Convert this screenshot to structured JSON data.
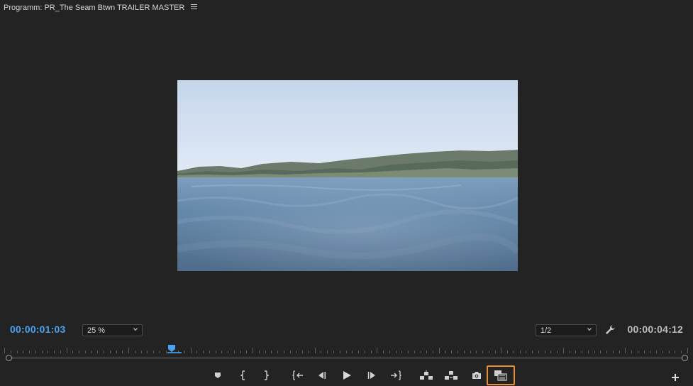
{
  "panel": {
    "title": "Programm: PR_The Seam Btwn TRAILER MASTER",
    "menu_icon": "hamburger-menu-icon"
  },
  "viewer": {
    "content": "video-frame-ocean-horizon"
  },
  "timecodes": {
    "current": "00:00:01:03",
    "duration": "00:00:04:12"
  },
  "zoom": {
    "selected": "25 %"
  },
  "playback_resolution": {
    "selected": "1/2"
  },
  "transport_buttons": [
    {
      "name": "add-marker-button",
      "icon": "marker-icon"
    },
    {
      "name": "mark-in-button",
      "icon": "mark-in-icon"
    },
    {
      "name": "mark-out-button",
      "icon": "mark-out-icon"
    },
    {
      "name": "go-to-in-button",
      "icon": "go-to-in-icon"
    },
    {
      "name": "step-back-button",
      "icon": "step-back-icon"
    },
    {
      "name": "play-button",
      "icon": "play-icon"
    },
    {
      "name": "step-forward-button",
      "icon": "step-forward-icon"
    },
    {
      "name": "go-to-out-button",
      "icon": "go-to-out-icon"
    },
    {
      "name": "lift-button",
      "icon": "lift-icon"
    },
    {
      "name": "extract-button",
      "icon": "extract-icon"
    },
    {
      "name": "export-frame-button",
      "icon": "camera-icon"
    },
    {
      "name": "comparison-view-button",
      "icon": "comparison-view-icon",
      "active": true
    }
  ],
  "colors": {
    "background": "#232323",
    "current_timecode": "#4aa3f0",
    "active_button_outline": "#e8902c",
    "playhead": "#4aa3f0"
  },
  "playhead_position": 0.245
}
